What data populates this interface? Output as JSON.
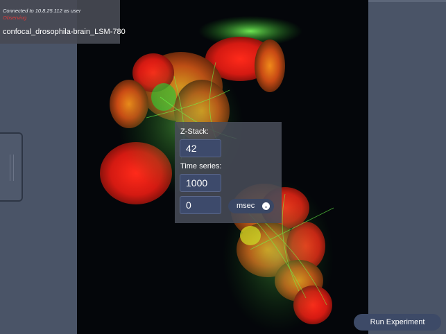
{
  "connection": {
    "status_line": "Connected to 10.8.25.112 as user",
    "state": "Observing",
    "device_name": "confocal_drosophila-brain_LSM-780"
  },
  "controls": {
    "zstack_label": "Z-Stack:",
    "zstack_value": "42",
    "timeseries_label": "Time series:",
    "timeseries_count": "1000",
    "interval_value": "0",
    "interval_unit": "msec"
  },
  "actions": {
    "run_label": "Run Experiment"
  },
  "icons": {
    "unit_dropdown": "chevron-down-icon",
    "side_handle": "drag-handle-icon"
  },
  "colors": {
    "background": "#4b5568",
    "status_error": "#e03a3a",
    "input_bg": "#3d4a6b",
    "button_bg": "#3d4a67"
  }
}
